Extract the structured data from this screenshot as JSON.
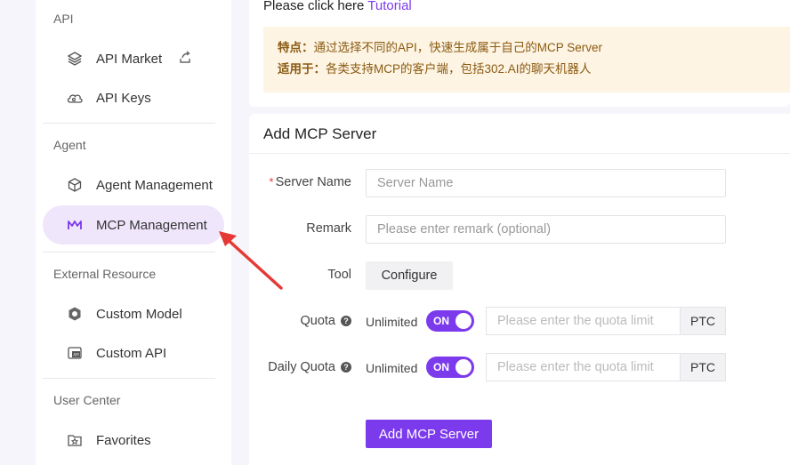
{
  "sidebar": {
    "sections": [
      {
        "title": "API",
        "items": [
          {
            "label": "API Market",
            "icon": "layers-icon"
          },
          {
            "label": "API Keys",
            "icon": "cloud-key-icon"
          }
        ]
      },
      {
        "title": "Agent",
        "items": [
          {
            "label": "Agent Management",
            "icon": "cube-icon"
          },
          {
            "label": "MCP Management",
            "icon": "mcp-logo-icon"
          }
        ]
      },
      {
        "title": "External Resource",
        "items": [
          {
            "label": "Custom Model",
            "icon": "model-icon"
          },
          {
            "label": "Custom API",
            "icon": "api-icon"
          }
        ]
      },
      {
        "title": "User Center",
        "items": [
          {
            "label": "Favorites",
            "icon": "star-folder-icon"
          }
        ]
      }
    ],
    "active": "MCP Management"
  },
  "top": {
    "click_prefix": "Please click here ",
    "tutorial_link": "Tutorial",
    "notice_line1_label": "特点：",
    "notice_line1_text": "通过选择不同的API，快速生成属于自己的MCP Server",
    "notice_line2_label": "适用于：",
    "notice_line2_text": "各类支持MCP的客户端，包括302.AI的聊天机器人"
  },
  "form": {
    "title": "Add MCP Server",
    "server_name_label": "Server Name",
    "server_name_placeholder": "Server Name",
    "remark_label": "Remark",
    "remark_placeholder": "Please enter remark (optional)",
    "tool_label": "Tool",
    "configure_label": "Configure",
    "quota_label": "Quota",
    "daily_quota_label": "Daily Quota",
    "unlimited_label": "Unlimited",
    "toggle_on": "ON",
    "quota_placeholder": "Please enter the quota limit",
    "unit": "PTC",
    "submit_label": "Add MCP Server"
  },
  "colors": {
    "accent": "#7c3aed",
    "notice_bg": "#fdf4e3",
    "arrow": "#e53935"
  }
}
